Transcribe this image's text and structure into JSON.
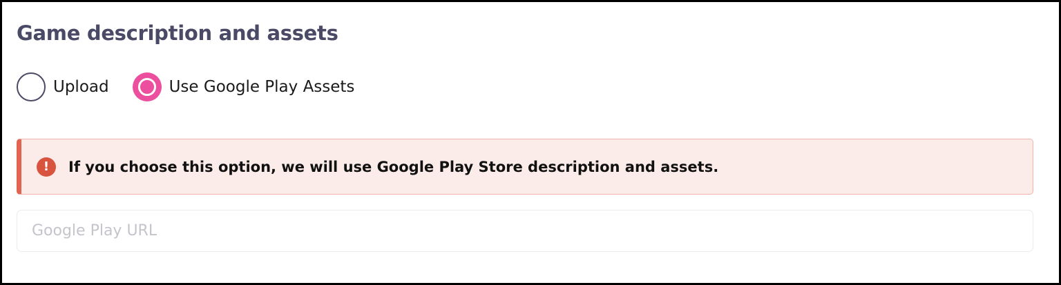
{
  "section": {
    "title": "Game description and assets"
  },
  "radio_options": [
    {
      "label": "Upload",
      "selected": false
    },
    {
      "label": "Use Google Play Assets",
      "selected": true
    }
  ],
  "alert": {
    "icon": "exclamation-icon",
    "icon_glyph": "!",
    "message": "If you choose this option, we will use Google Play Store description and assets."
  },
  "url_field": {
    "placeholder": "Google Play URL",
    "value": ""
  },
  "colors": {
    "accent": "#ec4f9e",
    "alert_border": "#e0644f",
    "alert_background": "#fcece9",
    "title": "#4a4a66"
  }
}
